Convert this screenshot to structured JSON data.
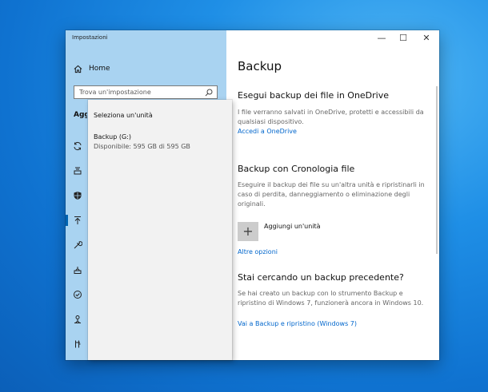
{
  "window": {
    "title": "Impostazioni",
    "minimize": "—",
    "maximize": "☐",
    "close": "✕"
  },
  "sidebar": {
    "home_label": "Home",
    "search_placeholder": "Trova un'impostazione",
    "section_label": "Aggiornamento e sicurezza",
    "nav_icons": [
      "sync-icon",
      "delivery-icon",
      "shield-icon",
      "backup-icon",
      "wrench-icon",
      "recovery-icon",
      "activation-icon",
      "find-device-icon",
      "developer-icon"
    ]
  },
  "flyout": {
    "heading": "Seleziona un'unità",
    "drive_name": "Backup (G:)",
    "drive_free": "Disponibile: 595 GB di 595 GB"
  },
  "main": {
    "page_title": "Backup",
    "onedrive": {
      "heading": "Esegui backup dei file in OneDrive",
      "text": "I file verranno salvati in OneDrive, protetti e accessibili da qualsiasi dispositivo.",
      "link": "Accedi a OneDrive"
    },
    "history": {
      "heading": "Backup con Cronologia file",
      "text": "Eseguire il backup dei file su un'altra unità e ripristinarli in caso di perdita, danneggiamento o eliminazione degli originali.",
      "add_icon": "+",
      "add_label": "Aggiungi un'unità",
      "more_link": "Altre opzioni"
    },
    "older": {
      "heading": "Stai cercando un backup precedente?",
      "text": "Se hai creato un backup con lo strumento Backup e ripristino di Windows 7, funzionerà ancora in Windows 10.",
      "link": "Vai a Backup e ripristino (Windows 7)"
    }
  },
  "colors": {
    "sidebar_bg": "#a9d3f1",
    "accent": "#0066cc",
    "flyout_bg": "#f2f2f2"
  }
}
